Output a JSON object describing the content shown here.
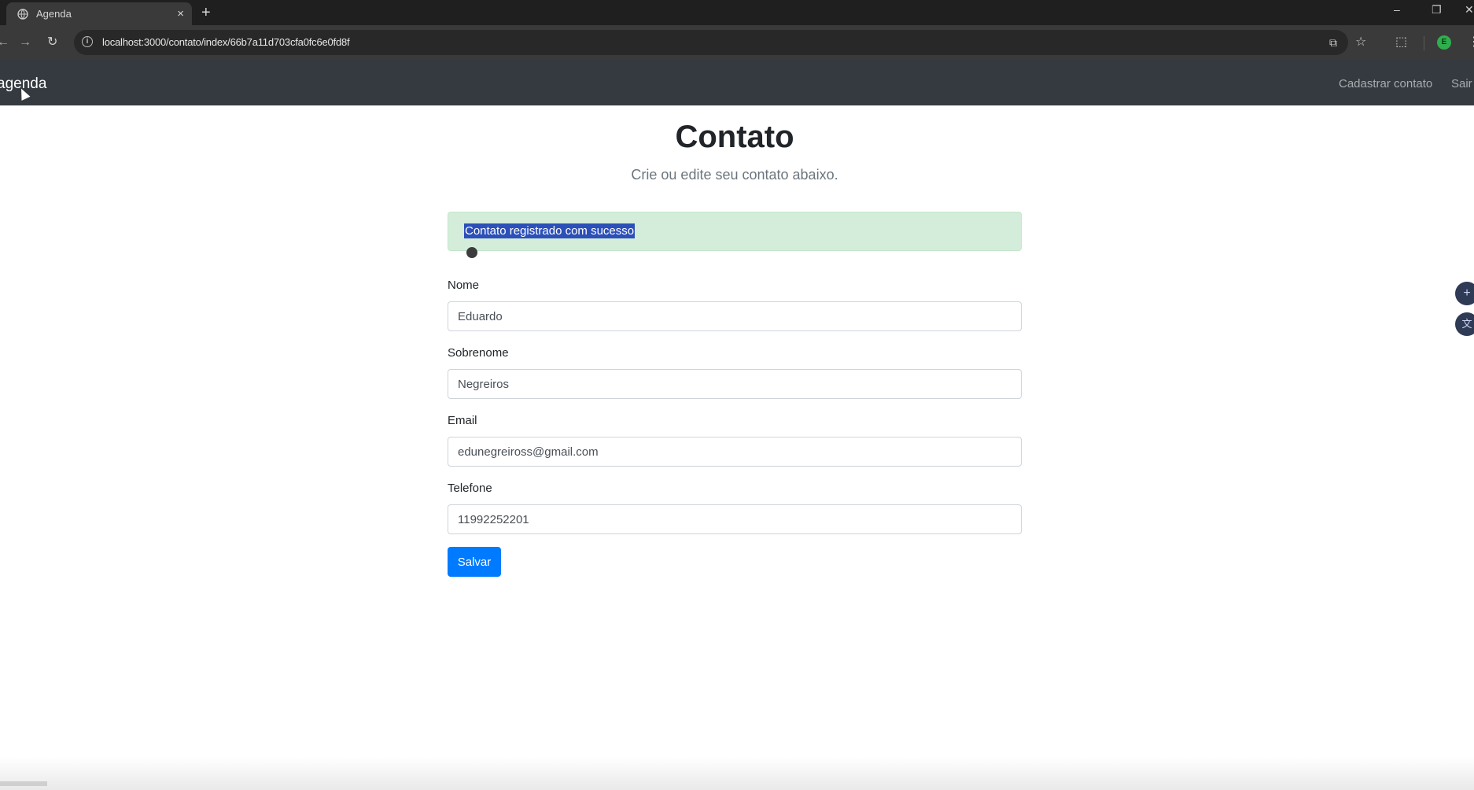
{
  "browser": {
    "tab_title": "Agenda",
    "tab_close": "×",
    "new_tab": "+",
    "url": "localhost:3000/contato/index/66b7a11d703cfa0fc6e0fd8f",
    "profile_initial": "E",
    "icons": [
      "back-icon",
      "forward-icon",
      "reload-icon",
      "site-info-icon",
      "screenshot-icon",
      "star-icon",
      "extensions-icon",
      "menu-icon"
    ],
    "window_controls": [
      "–",
      "❐",
      "✕"
    ]
  },
  "navbar": {
    "brand": "agenda",
    "links": [
      "Cadastrar contato",
      "Sair"
    ],
    "background": "#343a40"
  },
  "main": {
    "title": "Contato",
    "subtitle": "Crie ou edite seu contato abaixo.",
    "alert": {
      "text": "Contato registrado com sucesso",
      "color": "#d4edda"
    },
    "form": {
      "fields": [
        {
          "label": "Nome",
          "value": "Eduardo"
        },
        {
          "label": "Sobrenome",
          "value": "Negreiros"
        },
        {
          "label": "Email",
          "value": "edunegreiross@gmail.com"
        },
        {
          "label": "Telefone",
          "value": "11992252201"
        }
      ],
      "submit_label": "Salvar",
      "submit_color": "#007bff"
    }
  }
}
